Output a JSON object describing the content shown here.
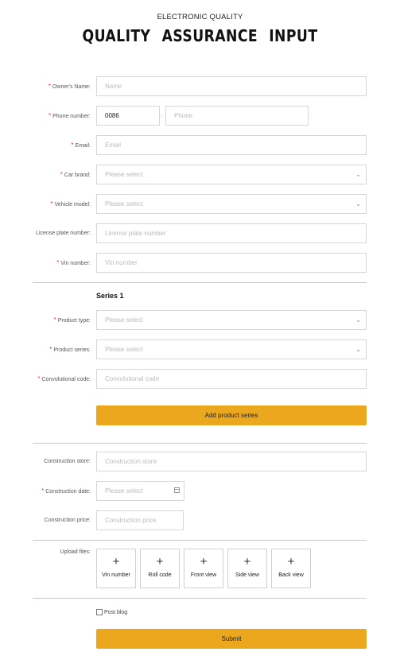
{
  "header": {
    "subtitle": "ELECTRONIC QUALITY",
    "title": "QUALITY ASSURANCE INPUT"
  },
  "owner": {
    "label": "Owner's Name:",
    "placeholder": "Name"
  },
  "phone": {
    "label": "Phone number:",
    "code": "0086",
    "dash": "-",
    "placeholder": "Phone"
  },
  "email": {
    "label": "Email:",
    "placeholder": "Email"
  },
  "car_brand": {
    "label": "Car brand:",
    "placeholder": "Please select"
  },
  "vehicle_model": {
    "label": "Vehicle model:",
    "placeholder": "Please select"
  },
  "license": {
    "label": "License plate number:",
    "placeholder": "License plate number"
  },
  "vin": {
    "label": "Vin number:",
    "placeholder": "Vin number"
  },
  "series": {
    "title": "Series 1"
  },
  "product_type": {
    "label": "Product type:",
    "placeholder": "Please select"
  },
  "product_series": {
    "label": "Product series:",
    "placeholder": "Please select"
  },
  "conv_code": {
    "label": "Convolutional code:",
    "placeholder": "Convolutional code"
  },
  "add_series": {
    "label": "Add product series"
  },
  "store": {
    "label": "Construction store:",
    "placeholder": "Construction store"
  },
  "date": {
    "label": "Construction date:",
    "placeholder": "Please select"
  },
  "price": {
    "label": "Construction price:",
    "placeholder": "Construction price"
  },
  "upload": {
    "label": "Upload files:",
    "plus": "+",
    "items": [
      {
        "label": "Vin number"
      },
      {
        "label": "Roll code"
      },
      {
        "label": "Front view"
      },
      {
        "label": "Side view"
      },
      {
        "label": "Back view"
      }
    ]
  },
  "post_blog": {
    "label": "Post blog"
  },
  "submit": {
    "label": "Submit"
  },
  "icons": {
    "chevron": "chevron-down-icon",
    "calendar": "calendar-icon",
    "plus": "plus-icon"
  },
  "colors": {
    "accent": "#eba81f",
    "required": "#e23b3b"
  }
}
